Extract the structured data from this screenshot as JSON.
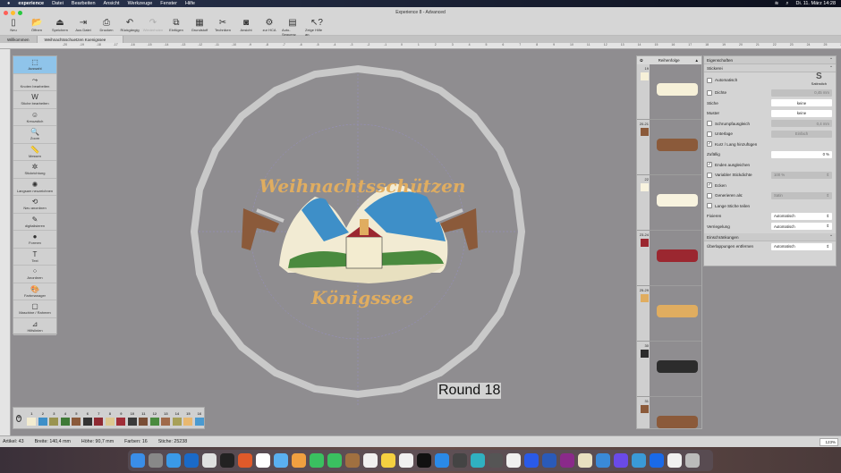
{
  "menubar": {
    "app": "experience",
    "items": [
      "Datei",
      "Bearbeiten",
      "Ansicht",
      "Werkzeuge",
      "Fenster",
      "Hilfe"
    ],
    "clock": "Di. 11. März  14:28"
  },
  "window": {
    "title": "Experience 8 - Advanced"
  },
  "toolbar": [
    {
      "label": "Neu",
      "icon": "new-file-icon",
      "glyph": "▯",
      "enabled": true
    },
    {
      "label": "Öffnen",
      "icon": "folder-icon",
      "glyph": "📂",
      "enabled": true
    },
    {
      "label": "Speichern",
      "icon": "save-icon",
      "glyph": "⏏",
      "enabled": true
    },
    {
      "label": "Aus Datei",
      "icon": "import-icon",
      "glyph": "⇥",
      "enabled": true
    },
    {
      "label": "Drucken",
      "icon": "printer-icon",
      "glyph": "⎙",
      "enabled": true
    },
    {
      "label": "Rückgängig",
      "icon": "undo-icon",
      "glyph": "↶",
      "enabled": true
    },
    {
      "label": "Wiederholen",
      "icon": "redo-icon",
      "glyph": "↷",
      "enabled": false
    },
    {
      "label": "Einfügen",
      "icon": "paste-icon",
      "glyph": "⧉",
      "enabled": true
    },
    {
      "label": "Grundstoff",
      "icon": "fabric-icon",
      "glyph": "▦",
      "enabled": true
    },
    {
      "label": "Techniken",
      "icon": "techniques-icon",
      "glyph": "✂",
      "enabled": true
    },
    {
      "label": "Ansicht",
      "icon": "view-icon",
      "glyph": "◙",
      "enabled": true
    },
    {
      "label": "zur HCA",
      "icon": "machine-icon",
      "glyph": "⚙",
      "enabled": true
    },
    {
      "label": "Auto-Sequenz",
      "icon": "auto-sequence-icon",
      "glyph": "▤",
      "enabled": true
    },
    {
      "label": "Zeige Hilfe an",
      "icon": "help-icon",
      "glyph": "↖?",
      "enabled": true
    }
  ],
  "tabs": [
    "Willkommen",
    "Weihnachtsschuetzen Koenigssee 207603*"
  ],
  "ruler_ticks": [
    -20,
    -19,
    -18,
    -17,
    -16,
    -15,
    -14,
    -13,
    -12,
    -11,
    -10,
    -9,
    -8,
    -7,
    -6,
    -5,
    -4,
    -3,
    -2,
    -1,
    0,
    1,
    2,
    3,
    4,
    5,
    6,
    7,
    8,
    9,
    10,
    11,
    12,
    13,
    14,
    15,
    16,
    17,
    18,
    19,
    20,
    21,
    22,
    23,
    24,
    25,
    26,
    27
  ],
  "tools": [
    {
      "label": "Auswahl",
      "icon": "select-icon",
      "glyph": "⬚",
      "selected": true
    },
    {
      "label": "Knoten bearbeiten",
      "icon": "node-edit-icon",
      "glyph": "⤳"
    },
    {
      "label": "Stiche bearbeiten",
      "icon": "stitch-edit-icon",
      "glyph": "W"
    },
    {
      "label": "Kreuzstich",
      "icon": "cross-stitch-icon",
      "glyph": "☺"
    },
    {
      "label": "Zoom",
      "icon": "zoom-icon",
      "glyph": "🔍"
    },
    {
      "label": "Messen",
      "icon": "measure-icon",
      "glyph": "📏"
    },
    {
      "label": "Stickrichtung",
      "icon": "stitch-direction-icon",
      "glyph": "✲"
    },
    {
      "label": "Langsam neuzeichnen",
      "icon": "slow-redraw-icon",
      "glyph": "✺"
    },
    {
      "label": "Neu anordnen",
      "icon": "reorder-icon",
      "glyph": "⟲"
    },
    {
      "label": "digitalisieren",
      "icon": "digitize-icon",
      "glyph": "✎"
    },
    {
      "label": "Formen",
      "icon": "shapes-icon",
      "glyph": "●"
    },
    {
      "label": "Text",
      "icon": "text-icon",
      "glyph": "T"
    },
    {
      "label": "Anordnen",
      "icon": "arrange-icon",
      "glyph": "⁘"
    },
    {
      "label": "Farbmanager",
      "icon": "palette-icon",
      "glyph": "🎨"
    },
    {
      "label": "Maschine / Rahmen",
      "icon": "hoop-icon",
      "glyph": "▢"
    },
    {
      "label": "Hilfslinien",
      "icon": "guides-icon",
      "glyph": "⊿"
    }
  ],
  "design": {
    "top_text": "Weihnachtsschützen",
    "bottom_text": "Königssee",
    "overlay_label": "Round 18"
  },
  "sequence": {
    "title": "Reihenfolge",
    "rows": [
      {
        "num": "19",
        "color": "#f6f0d8"
      },
      {
        "num": "20-21",
        "color": "#8b5a3a"
      },
      {
        "num": "22",
        "color": "#f8f3df"
      },
      {
        "num": "23-24",
        "color": "#9b2730"
      },
      {
        "num": "25-29",
        "color": "#e0ad60"
      },
      {
        "num": "30",
        "color": "#2c2c2c"
      },
      {
        "num": "31",
        "color": "#8b5a3a"
      }
    ]
  },
  "properties": {
    "title": "Eigenschaften",
    "section": "Stickerei",
    "stitch_type": "Satinstich",
    "rows": [
      {
        "label": "Automatisch",
        "check": false
      },
      {
        "label": "Dichte",
        "check": false,
        "value": "0,45 mm",
        "style": "dis r"
      },
      {
        "label": "Stiche",
        "value": "keine",
        "style": ""
      },
      {
        "label": "Muster",
        "value": "keine",
        "style": ""
      },
      {
        "label": "Schrumpfausgleich",
        "check": false,
        "value": "0,4 mm",
        "style": "dis r"
      },
      {
        "label": "Unterlage",
        "check": false,
        "value": "Einfach",
        "style": "dis"
      },
      {
        "label": "Kurz / Lang hinzufügen",
        "check": true
      },
      {
        "label": "Zufällig",
        "value": "0 %",
        "style": "r"
      },
      {
        "label": "Enden ausgleichen",
        "check": true
      },
      {
        "label": "Variabler Stickdichte",
        "check": false,
        "value": "100 %",
        "style": "dis sel"
      },
      {
        "label": "Ecken",
        "check": true
      },
      {
        "label": "Generieren als:",
        "check": false,
        "value": "Satin",
        "style": "dis sel"
      },
      {
        "label": "Lange Stiche teilen",
        "check": false
      },
      {
        "label": "Fixieren",
        "value": "Automatisch",
        "style": "sel"
      },
      {
        "label": "Verriegelung",
        "value": "Automatisch",
        "style": "sel"
      }
    ],
    "constraints_title": "Einschränkungen",
    "overlap_label": "Überlappungen entfernen",
    "overlap_value": "Automatisch"
  },
  "colors": [
    {
      "n": "1",
      "c": "#f3ecd0"
    },
    {
      "n": "2",
      "c": "#3e8fc8"
    },
    {
      "n": "3",
      "c": "#9a9450"
    },
    {
      "n": "4",
      "c": "#3f7a36"
    },
    {
      "n": "5",
      "c": "#8b5a3a"
    },
    {
      "n": "6",
      "c": "#333333"
    },
    {
      "n": "7",
      "c": "#8e2a32"
    },
    {
      "n": "8",
      "c": "#ddc890"
    },
    {
      "n": "9",
      "c": "#a02e38"
    },
    {
      "n": "10",
      "c": "#3a3a3a"
    },
    {
      "n": "11",
      "c": "#7a4e36"
    },
    {
      "n": "12",
      "c": "#4a8a3e"
    },
    {
      "n": "13",
      "c": "#a06a4a"
    },
    {
      "n": "14",
      "c": "#a8a058"
    },
    {
      "n": "15",
      "c": "#e8b870"
    },
    {
      "n": "16",
      "c": "#4a9ad0"
    }
  ],
  "status": {
    "artikel": "Artikel: 43",
    "breite": "Breite: 140,4 mm",
    "hoehe": "Höhe: 90,7 mm",
    "farben": "Farben: 16",
    "stiche": "Stiche: 25238",
    "zoom": "123%"
  },
  "dock_colors": [
    "#3a8ee8",
    "#888",
    "#3a9ae8",
    "#1a6ac8",
    "#e0e0e0",
    "#222",
    "#e05a2a",
    "#fff",
    "#5ab0f0",
    "#f0a040",
    "#3ac060",
    "#3ac060",
    "#a07040",
    "#f0f0f0",
    "#f4d040",
    "#f0f0f0",
    "#111",
    "#2a8ae8",
    "#444",
    "#30b0c0",
    "#555",
    "#f0f0f0",
    "#2a5ae8",
    "#2a5ab8",
    "#8a2a8a",
    "#e8e0c0",
    "#3a8ad8",
    "#6a4ae8",
    "#3a9ad8",
    "#1a6ae8",
    "#f0f0f0",
    "#bbb"
  ]
}
